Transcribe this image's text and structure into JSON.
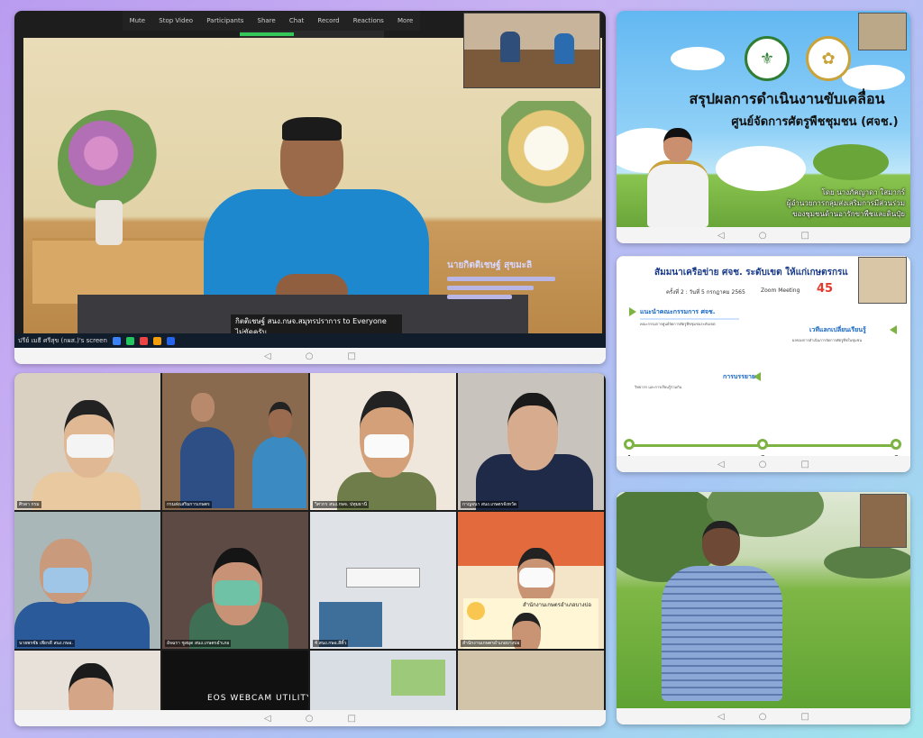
{
  "panel1": {
    "chat_sender": "กิตติเชษฐ์ สนง.กษจ.สมุทรปราการ to Everyone",
    "chat_message": "ไม่ขัดครับ",
    "presenter_name": "นายกิตติเชษฐ์ สุขมะลิ",
    "screen_share_label": "ปรีย์ เมธี ศรีสุข (กผส.)'s screen",
    "zoom_toolbar": [
      "Mute",
      "Stop Video",
      "Participants",
      "Share",
      "Chat",
      "Record",
      "Reactions",
      "More"
    ],
    "navbar": [
      "◁",
      "○",
      "□"
    ]
  },
  "panel2": {
    "title": "สรุปผลการดำเนินงานขับเคลื่อน",
    "subtitle": "ศูนย์จัดการศัตรูพืชชุมชน (ศจช.)",
    "by_line1": "โดย นางภัคญาดา ใสมากร์",
    "by_line2": "ผู้อำนวยการกลุ่มส่งเสริมการมีส่วนร่วม",
    "by_line3": "ของชุมชนด้านอารักขาพืชและดินปุ๋ย",
    "navbar": [
      "◁",
      "○",
      "□"
    ]
  },
  "panel3": {
    "title": "สัมมนาเครือข่าย ศจช. ระดับเขต ให้แก่เกษตรกรแ",
    "meta": "ครั้งที่ 2 : วันที่ 5 กรกฎาคม 2565",
    "zoom": "Zoom Meeting",
    "badge": "45",
    "section1": "แนะนำคณะกรรมการ ศจช.",
    "section2": "การบรรยาย",
    "section3": "เวทีแลกเปลี่ยนเรียนรู้",
    "text1": "คณะกรรมการศูนย์จัดการศัตรูพืชชุมชนระดับเขต",
    "text2": "วิทยากร และการเรียนรู้ร่วมกัน",
    "text3": "ผลของการดำเนินการจัดการศัตรูพืชในชุมชน",
    "steps": [
      "1",
      "2",
      "3"
    ],
    "navbar": [
      "◁",
      "○",
      "□"
    ]
  },
  "panel4": {
    "participants": [
      "ศิรดา กรม",
      "กรมส่งเสริมการเกษตร",
      "วิศวกร สนง.กษจ. ปทุมธานี",
      "กาญจนา สนง.เกษตรจังหวัด",
      "นายพรชัย เพียรดี สนง.กษอ.",
      "อัจฉรา ชูสมุด สนง.เกษตรอำเภอ",
      "4 สนง.กษอ.สีคิ้ว",
      "สำนักงานเกษตรอำเภอบางบ่อ"
    ],
    "webcam_text": "EOS WEBCAM UTILITY",
    "org_label": "สำนักงานเกษตรอำเภอบางบ่อ",
    "navbar": [
      "◁",
      "○",
      "□"
    ]
  },
  "panel5": {
    "navbar": [
      "◁",
      "○",
      "□"
    ]
  }
}
